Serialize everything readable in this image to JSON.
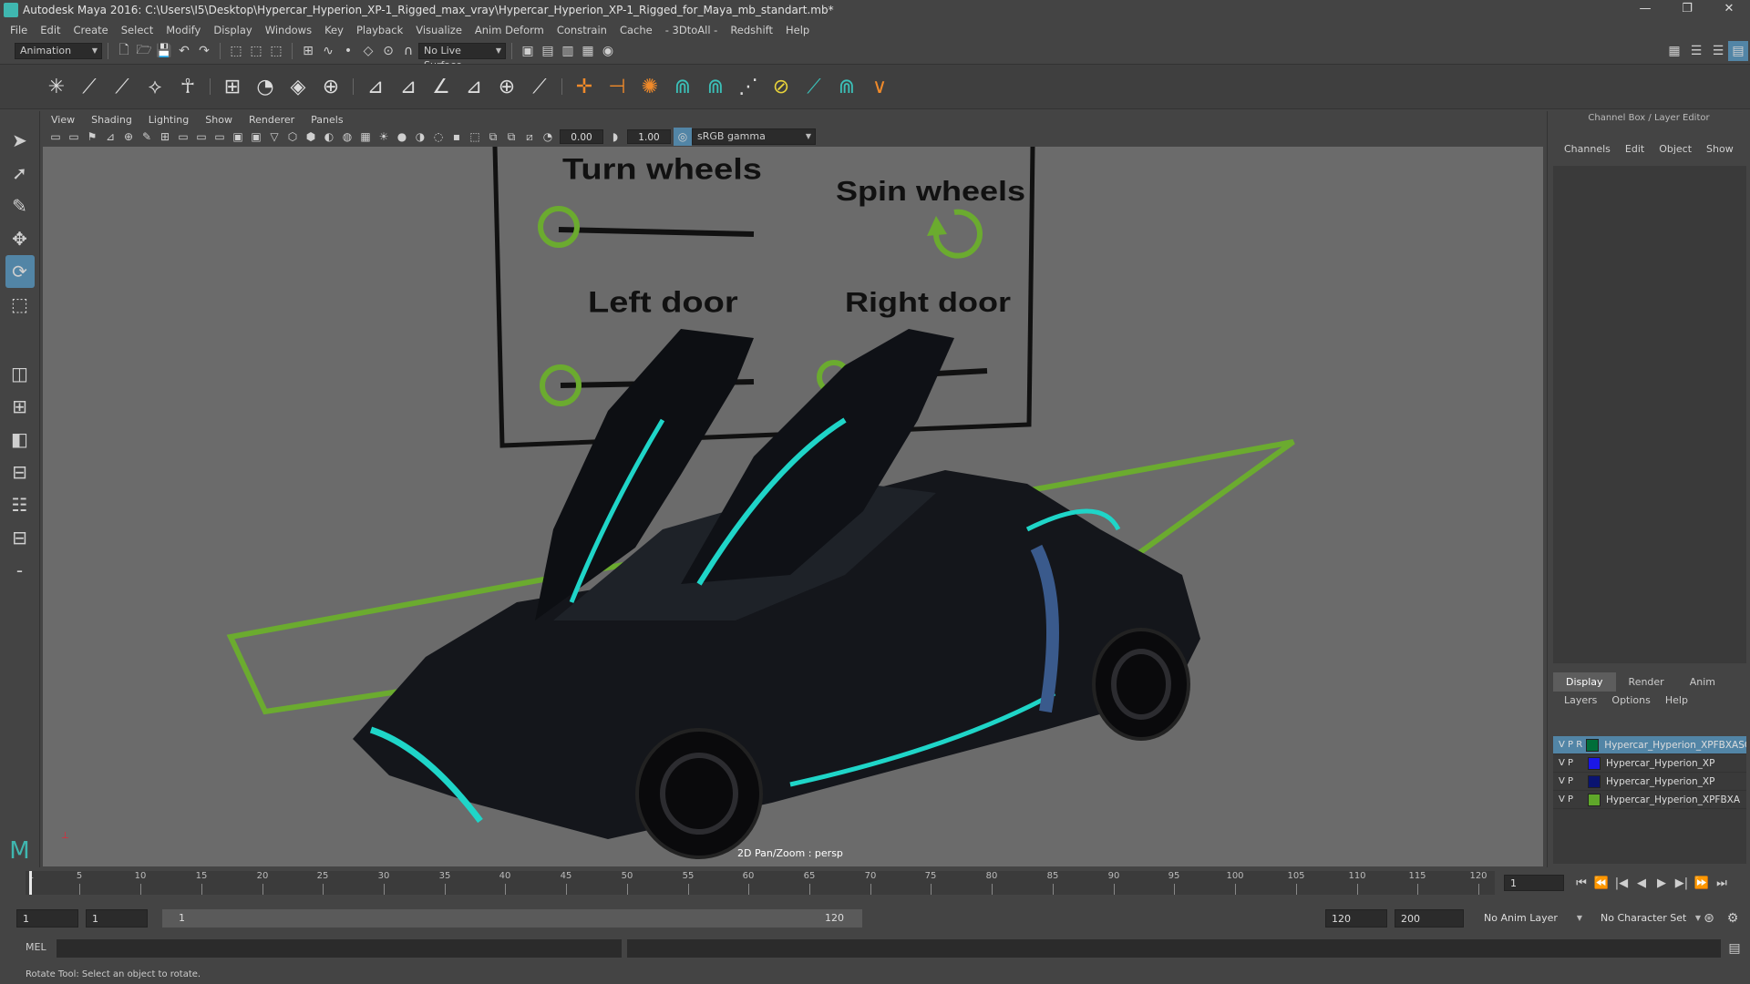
{
  "window": {
    "title": "Autodesk Maya 2016: C:\\Users\\I5\\Desktop\\Hypercar_Hyperion_XP-1_Rigged_max_vray\\Hypercar_Hyperion_XP-1_Rigged_for_Maya_mb_standart.mb*",
    "controls": [
      "—",
      "❐",
      "✕"
    ]
  },
  "menubar": [
    "File",
    "Edit",
    "Create",
    "Select",
    "Modify",
    "Display",
    "Windows",
    "Key",
    "Playback",
    "Visualize",
    "Anim Deform",
    "Constrain",
    "Cache",
    "- 3DtoAll -",
    "Redshift",
    "Help"
  ],
  "statusline": {
    "mode": "Animation",
    "live_surface": "No Live Surface"
  },
  "panel": {
    "menu": [
      "View",
      "Shading",
      "Lighting",
      "Show",
      "Renderer",
      "Panels"
    ],
    "exposure": "0.00",
    "gamma": "1.00",
    "color_space": "sRGB gamma"
  },
  "viewport": {
    "label": "2D Pan/Zoom : persp",
    "rig_labels": {
      "turn_wheels": "Turn wheels",
      "spin_wheels": "Spin wheels",
      "left_door": "Left door",
      "right_door": "Right door"
    },
    "colors": {
      "control_green": "#6bab2f",
      "teal_accent": "#1fd5c8",
      "car_body": "#14161b"
    }
  },
  "channelbox": {
    "title": "Channel Box / Layer Editor",
    "menu": [
      "Channels",
      "Edit",
      "Object",
      "Show"
    ],
    "tabs": [
      "Display",
      "Render",
      "Anim"
    ],
    "layer_menu": [
      "Layers",
      "Options",
      "Help"
    ],
    "layers": [
      {
        "v": "V",
        "p": "P",
        "r": "R",
        "name": "Hypercar_Hyperion_XPFBXASC",
        "color": "#006e3a",
        "selected": true
      },
      {
        "v": "V",
        "p": "P",
        "r": "",
        "name": "Hypercar_Hyperion_XP",
        "color": "#1b17e6",
        "selected": false
      },
      {
        "v": "V",
        "p": "P",
        "r": "",
        "name": "Hypercar_Hyperion_XP",
        "color": "#0a1470",
        "selected": false
      },
      {
        "v": "V",
        "p": "P",
        "r": "",
        "name": "Hypercar_Hyperion_XPFBXA",
        "color": "#5fa72a",
        "selected": false
      }
    ]
  },
  "timeline": {
    "ticks": [
      "1",
      "5",
      "10",
      "15",
      "20",
      "25",
      "30",
      "35",
      "40",
      "45",
      "50",
      "55",
      "60",
      "65",
      "70",
      "75",
      "80",
      "85",
      "90",
      "95",
      "100",
      "105",
      "110",
      "115",
      "120"
    ],
    "current_frame": "1"
  },
  "range": {
    "start": "1",
    "playback_start": "1",
    "slider_start": "1",
    "slider_end": "120",
    "playback_end": "120",
    "end": "200",
    "anim_layer": "No Anim Layer",
    "character_set": "No Character Set"
  },
  "cmdline": {
    "label": "MEL"
  },
  "status": {
    "help": "Rotate Tool: Select an object to rotate."
  }
}
